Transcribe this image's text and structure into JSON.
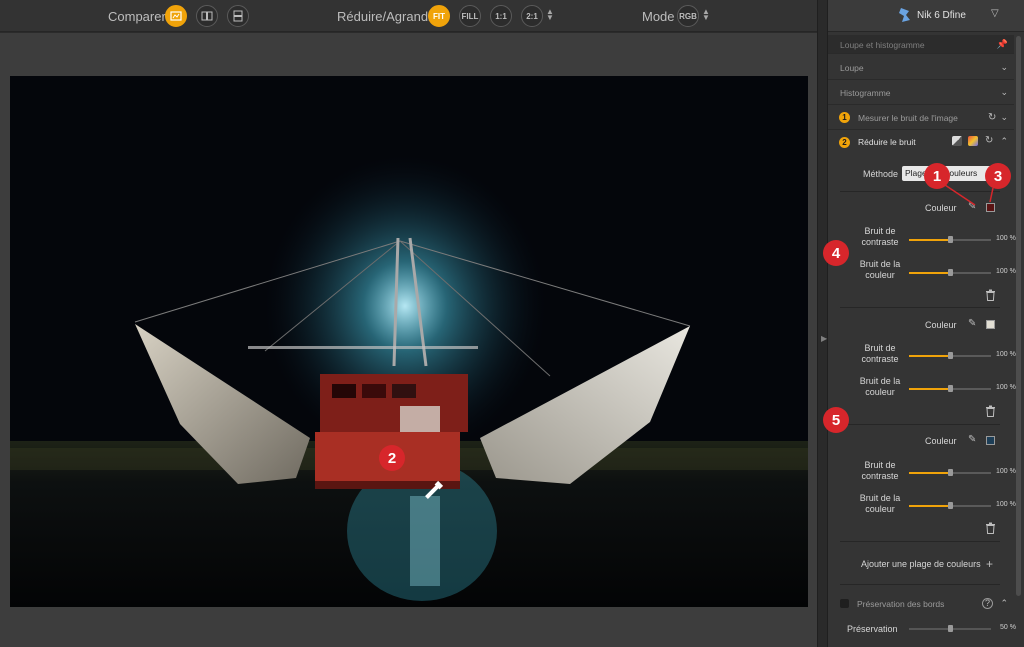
{
  "toolbar": {
    "compare_label": "Comparer",
    "zoom_label": "Réduire/Agrandir",
    "zoom_buttons": [
      "FIT",
      "FILL",
      "1:1",
      "2:1"
    ],
    "mode_label": "Mode",
    "mode_value": "RGB"
  },
  "panel": {
    "app_title": "Nik 6 Dfine",
    "loupe_histogram": "Loupe et histogramme",
    "loupe": "Loupe",
    "histogram": "Histogramme",
    "step1_number": "1",
    "step1_label": "Mesurer le bruit de l'image",
    "step2_number": "2",
    "step2_label": "Réduire le bruit",
    "method_label": "Méthode",
    "method_value": "Plages de couleurs",
    "color_label": "Couleur",
    "contrast_noise": "Bruit de contraste",
    "color_noise": "Bruit de la couleur",
    "add_range": "Ajouter une plage de couleurs",
    "edge_preservation": "Préservation des bords",
    "preservation_label": "Préservation",
    "preservation_value": "50 %",
    "ranges": [
      {
        "swatch": "#5a1414",
        "contrast_pct": "100 %",
        "color_pct": "100 %",
        "contrast": 1.0,
        "color": 1.0
      },
      {
        "swatch": "#e2dfd4",
        "contrast_pct": "100 %",
        "color_pct": "100 %",
        "contrast": 1.0,
        "color": 1.0
      },
      {
        "swatch": "#1d3e57",
        "contrast_pct": "100 %",
        "color_pct": "100 %",
        "contrast": 1.0,
        "color": 1.0
      }
    ],
    "preservation_level": 0.5
  },
  "annotations": [
    "1",
    "2",
    "3",
    "4",
    "5"
  ],
  "colors": {
    "accent": "#f0a30a",
    "badge": "#d7262b"
  }
}
